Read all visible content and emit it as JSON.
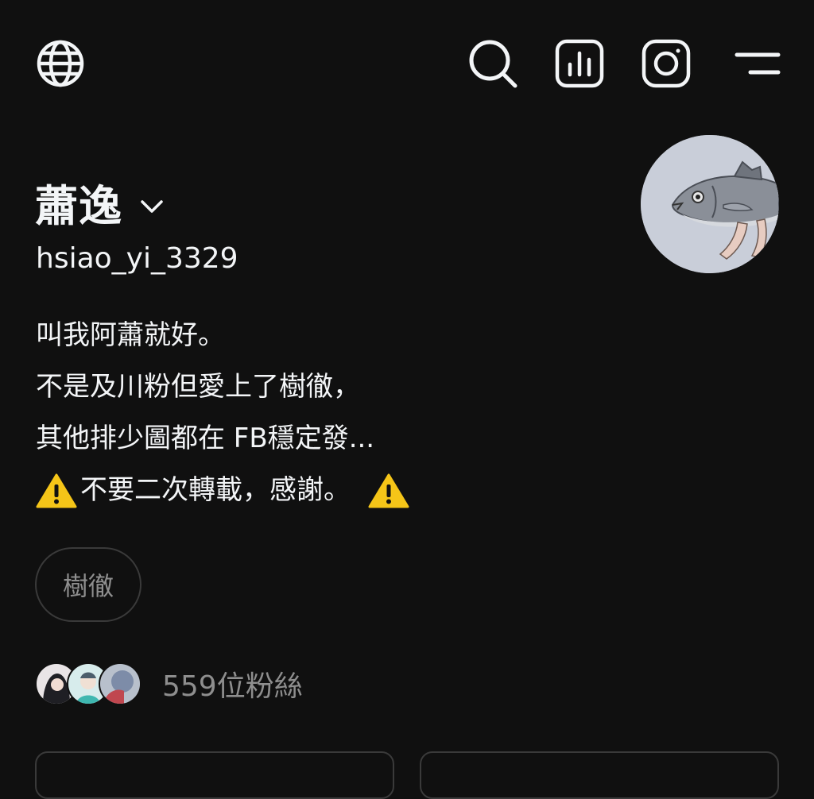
{
  "header": {
    "icons": [
      "globe-icon",
      "search-icon",
      "insights-icon",
      "instagram-icon",
      "menu-icon"
    ]
  },
  "profile": {
    "name": "蕭逸",
    "handle": "hsiao_yi_3329",
    "bio": {
      "line1": "叫我阿蕭就好。",
      "line2": "不是及川粉但愛上了樹徹，",
      "line3": "其他排少圖都在 FB穩定發...",
      "line4": "不要二次轉載，感謝。"
    },
    "tag": "樹徹",
    "followers_label": "559位粉絲"
  },
  "colors": {
    "background": "#101010",
    "text_primary": "#f3f5f7",
    "text_secondary": "#8e8e8e",
    "border": "#3a3a3a",
    "warning": "#f5c518"
  }
}
